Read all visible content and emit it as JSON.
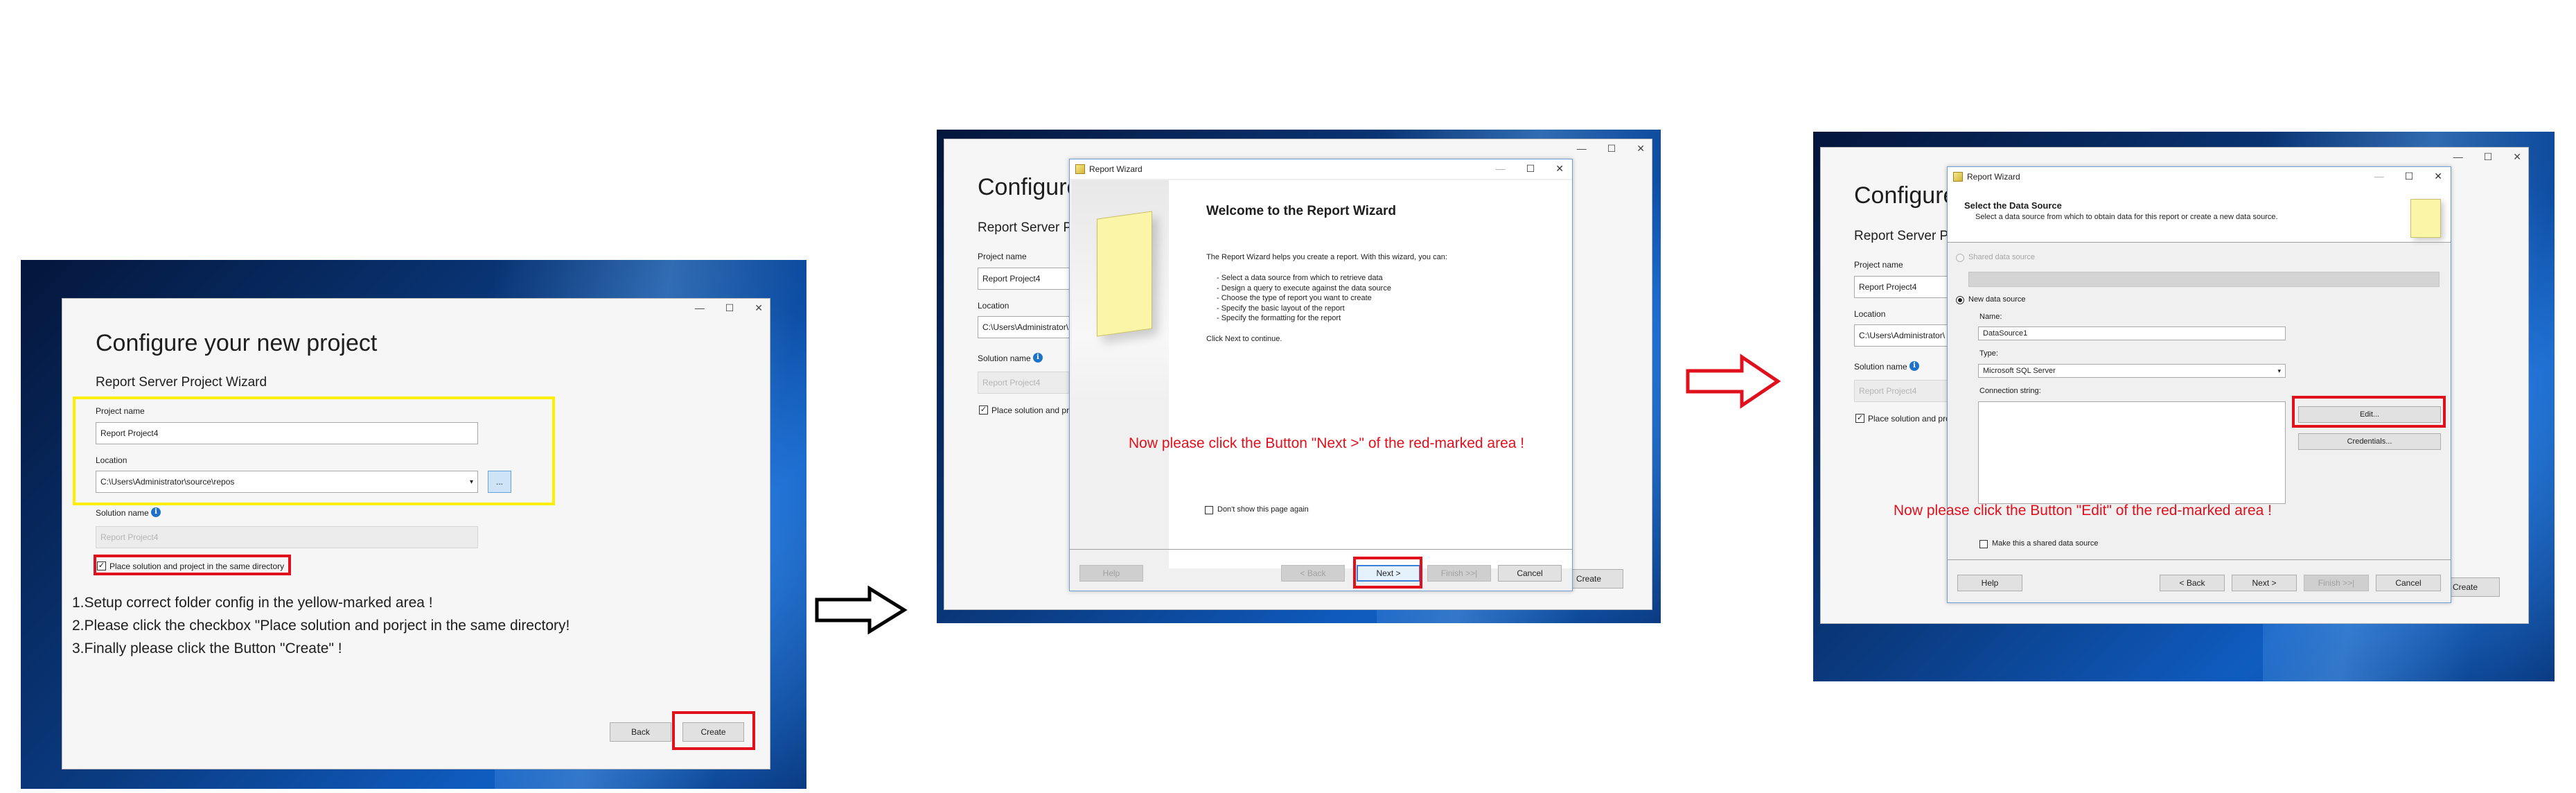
{
  "step1": {
    "title": "Configure your new project",
    "subtitle": "Report Server Project Wizard",
    "project_name_label": "Project name",
    "project_name_value": "Report Project4",
    "location_label": "Location",
    "location_value": "C:\\Users\\Administrator\\source\\repos",
    "browse_label": "...",
    "solution_name_label": "Solution name",
    "solution_name_value": "Report Project4",
    "checkbox_label": "Place solution and project in the same directory",
    "checkbox_checked": "✓",
    "instructions": [
      "1.Setup correct folder config in the yellow-marked area !",
      "2.Please click the checkbox \"Place solution and porject in the same directory!",
      "3.Finally please click the Button \"Create\" !"
    ],
    "back_label": "Back",
    "create_label": "Create"
  },
  "step2": {
    "bg_title": "Configure",
    "bg_subtitle": "Report Server Proj",
    "bg_project_name_label": "Project name",
    "bg_project_name_value": "Report Project4",
    "bg_location_label": "Location",
    "bg_location_value": "C:\\Users\\Administrator\\",
    "bg_solution_name_label": "Solution name",
    "bg_solution_name_value": "Report Project4",
    "bg_checkbox_label": "Place solution and pro",
    "bg_create_label": "Create",
    "wizard_title": "Report Wizard",
    "heading": "Welcome to the Report Wizard",
    "intro": "The Report Wizard helps you create a report. With this wizard, you can:",
    "bullets": [
      "- Select a data source from which to retrieve data",
      "- Design a query to execute against the data source",
      "- Choose the type of report you want to create",
      "- Specify the basic layout of the report",
      "- Specify the formatting for the report"
    ],
    "continue": "Click Next to continue.",
    "note": "Now please click the Button \"Next >\" of the red-marked area !",
    "dont_show": "Don't show this page again",
    "help_label": "Help",
    "back_label": "< Back",
    "next_label": "Next >",
    "finish_label": "Finish >>|",
    "cancel_label": "Cancel"
  },
  "step3": {
    "bg_title": "Configure",
    "bg_subtitle": "Report Server Proj",
    "bg_project_name_label": "Project name",
    "bg_project_name_value": "Report Project4",
    "bg_location_label": "Location",
    "bg_location_value": "C:\\Users\\Administrator\\",
    "bg_solution_name_label": "Solution name",
    "bg_solution_name_value": "Report Project4",
    "bg_checkbox_label": "Place solution and pro",
    "bg_create_label": "Create",
    "wizard_title": "Report Wizard",
    "heading": "Select the Data Source",
    "subheading": "Select a data source from which to obtain data for this report or create a new data source.",
    "shared_source_label": "Shared data source",
    "new_source_label": "New data source",
    "name_label": "Name:",
    "name_value": "DataSource1",
    "type_label": "Type:",
    "type_value": "Microsoft SQL Server",
    "connection_label": "Connection string:",
    "edit_label": "Edit...",
    "credentials_label": "Credentials...",
    "note": "Now please click the Button \"Edit\" of the red-marked area !",
    "shared_checkbox_label": "Make this a shared data source",
    "help_label": "Help",
    "back_label": "< Back",
    "next_label": "Next >",
    "finish_label": "Finish >>|",
    "cancel_label": "Cancel"
  },
  "colors": {
    "marker_red": "#e0101c",
    "marker_yellow": "#ffee00",
    "desktop_blue": "#0a3a7f"
  },
  "icons": [
    "minimize-icon",
    "maximize-icon",
    "close-icon",
    "info-icon",
    "dropdown-icon",
    "report-wizard-icon",
    "arrow-right-icon"
  ]
}
